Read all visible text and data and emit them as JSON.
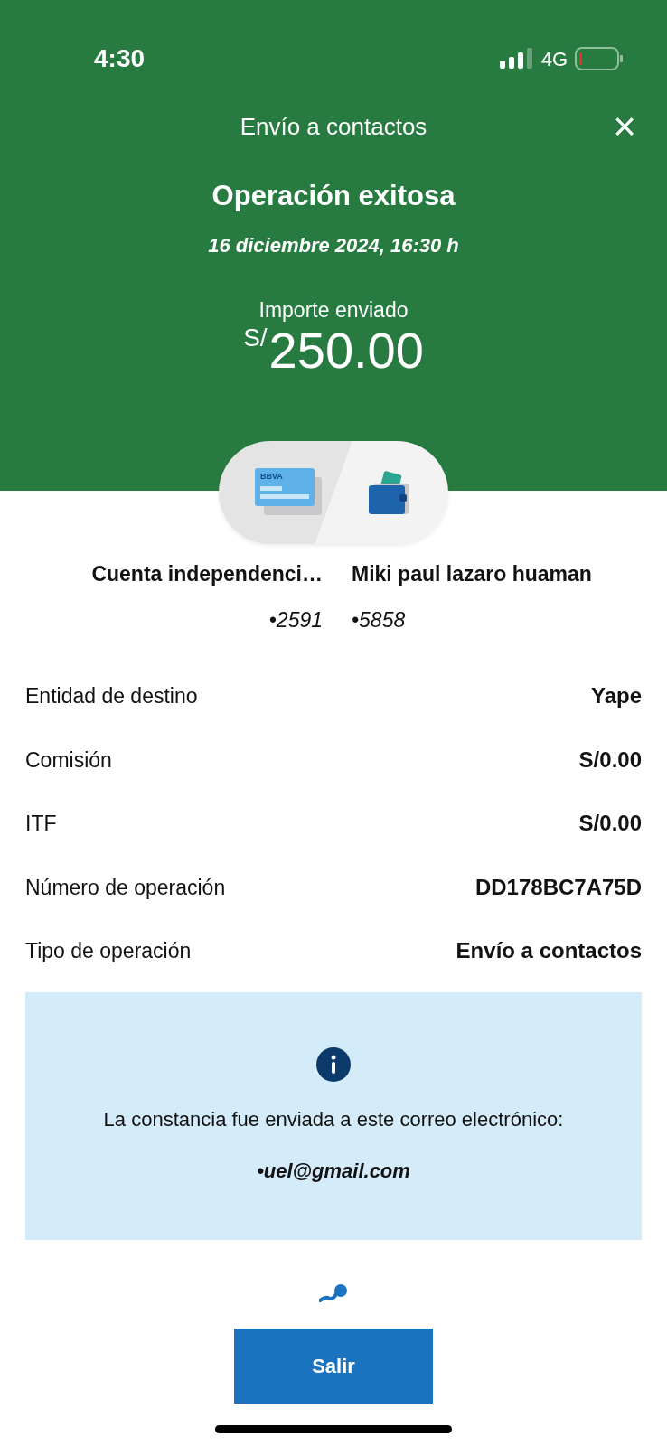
{
  "status_bar": {
    "time": "4:30",
    "network": "4G"
  },
  "header": {
    "title": "Envío a contactos",
    "close": "×"
  },
  "result": {
    "title": "Operación exitosa",
    "date": "16 diciembre 2024, 16:30 h",
    "amount_label": "Importe enviado",
    "currency": "S/",
    "amount": "250.00"
  },
  "transfer": {
    "card_label": "BBVA",
    "accounts": [
      {
        "name": "Cuenta independenci…",
        "number": "•2591"
      },
      {
        "name": "Miki paul lazaro huaman",
        "number": "•5858"
      }
    ]
  },
  "details": [
    {
      "label": "Entidad de destino",
      "value": "Yape"
    },
    {
      "label": "Comisión",
      "value": "S/0.00"
    },
    {
      "label": "ITF",
      "value": "S/0.00"
    },
    {
      "label": "Número de operación",
      "value": "DD178BC7A75D"
    },
    {
      "label": "Tipo de operación",
      "value": "Envío a contactos"
    }
  ],
  "notice": {
    "text": "La constancia fue enviada a este correo electrónico:",
    "email": "•uel@gmail.com"
  },
  "buttons": [
    "Salir"
  ]
}
